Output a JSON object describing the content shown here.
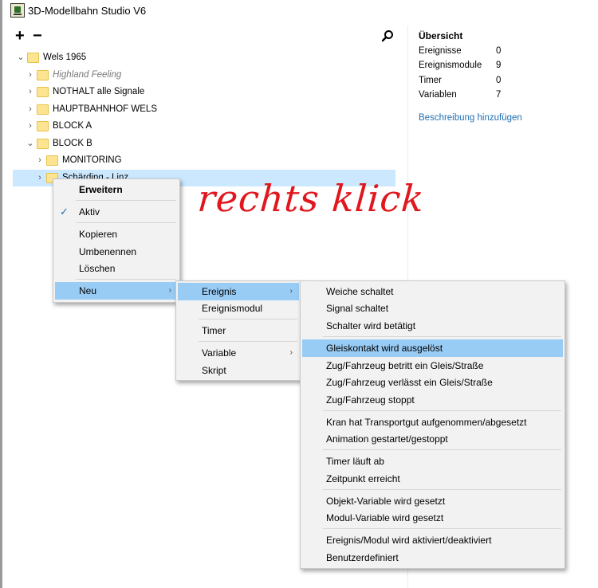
{
  "window": {
    "title": "3D-Modellbahn Studio V6"
  },
  "toolbar": {
    "add": "+",
    "remove": "−"
  },
  "tree": {
    "items": [
      {
        "label": "Wels 1965",
        "chevron": "⌄",
        "italic": false
      },
      {
        "label": "Highland Feeling",
        "chevron": "›",
        "italic": true
      },
      {
        "label": "NOTHALT alle Signale",
        "chevron": "›",
        "italic": false
      },
      {
        "label": "HAUPTBAHNHOF WELS",
        "chevron": "›",
        "italic": false
      },
      {
        "label": "BLOCK  A",
        "chevron": "›",
        "italic": false
      },
      {
        "label": "BLOCK  B",
        "chevron": "⌄",
        "italic": false
      },
      {
        "label": "MONITORING",
        "chevron": "›",
        "italic": false
      },
      {
        "label": "Schärding - Linz",
        "chevron": "›",
        "italic": false
      }
    ]
  },
  "overview": {
    "title": "Übersicht",
    "rows": [
      {
        "label": "Ereignisse",
        "value": "0"
      },
      {
        "label": "Ereignismodule",
        "value": "9"
      },
      {
        "label": "Timer",
        "value": "0"
      },
      {
        "label": "Variablen",
        "value": "7"
      }
    ],
    "link": "Beschreibung hinzufügen"
  },
  "annotation": "rechts klick",
  "context_menu": {
    "items": [
      {
        "label": "Erweitern"
      },
      {
        "label": "Aktiv",
        "check": "✓"
      },
      {
        "label": "Kopieren"
      },
      {
        "label": "Umbenennen"
      },
      {
        "label": "Löschen"
      },
      {
        "label": "Neu",
        "arrow": "›"
      }
    ]
  },
  "submenu_neu": {
    "items": [
      {
        "label": "Ereignis",
        "arrow": "›"
      },
      {
        "label": "Ereignismodul"
      },
      {
        "label": "Timer"
      },
      {
        "label": "Variable",
        "arrow": "›"
      },
      {
        "label": "Skript"
      }
    ]
  },
  "submenu_ereignis": {
    "items": [
      {
        "label": "Weiche schaltet"
      },
      {
        "label": "Signal schaltet"
      },
      {
        "label": "Schalter wird betätigt"
      },
      {
        "label": "Gleiskontakt wird ausgelöst"
      },
      {
        "label": "Zug/Fahrzeug betritt ein Gleis/Straße"
      },
      {
        "label": "Zug/Fahrzeug verlässt ein Gleis/Straße"
      },
      {
        "label": "Zug/Fahrzeug stoppt"
      },
      {
        "label": "Kran hat Transportgut aufgenommen/abgesetzt"
      },
      {
        "label": "Animation gestartet/gestoppt"
      },
      {
        "label": "Timer läuft ab"
      },
      {
        "label": "Zeitpunkt erreicht"
      },
      {
        "label": "Objekt-Variable wird gesetzt"
      },
      {
        "label": "Modul-Variable wird gesetzt"
      },
      {
        "label": "Ereignis/Modul wird aktiviert/deaktiviert"
      },
      {
        "label": "Benutzerdefiniert"
      }
    ]
  }
}
